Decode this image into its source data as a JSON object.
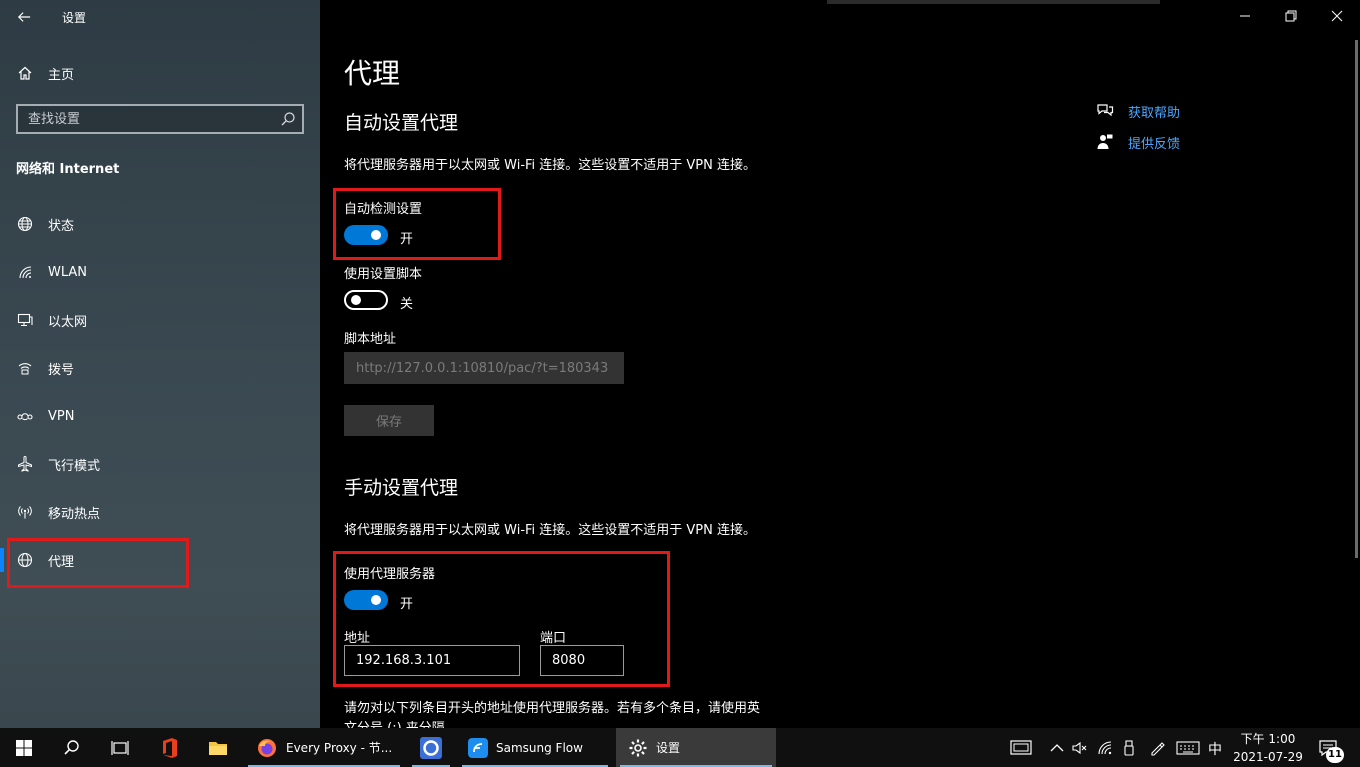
{
  "window": {
    "app_title": "设置",
    "back_icon": "back-arrow-icon",
    "minimize_icon": "minimize-icon",
    "restore_icon": "restore-icon",
    "close_icon": "close-icon"
  },
  "sidebar": {
    "home_label": "主页",
    "search_placeholder": "查找设置",
    "section_title": "网络和 Internet",
    "items": [
      {
        "label": "状态",
        "icon": "globe-status-icon"
      },
      {
        "label": "WLAN",
        "icon": "wifi-icon"
      },
      {
        "label": "以太网",
        "icon": "ethernet-icon"
      },
      {
        "label": "拨号",
        "icon": "dialup-icon"
      },
      {
        "label": "VPN",
        "icon": "vpn-icon"
      },
      {
        "label": "飞行模式",
        "icon": "airplane-icon"
      },
      {
        "label": "移动热点",
        "icon": "hotspot-icon"
      },
      {
        "label": "代理",
        "icon": "globe-icon",
        "selected": true
      }
    ]
  },
  "main": {
    "page_title": "代理",
    "auto": {
      "heading": "自动设置代理",
      "description": "将代理服务器用于以太网或 Wi-Fi 连接。这些设置不适用于 VPN 连接。",
      "detect_label": "自动检测设置",
      "detect_state": "开",
      "detect_on": true,
      "script_label": "使用设置脚本",
      "script_state": "关",
      "script_on": false,
      "address_label": "脚本地址",
      "address_value": "http://127.0.0.1:10810/pac/?t=180343",
      "save_label": "保存"
    },
    "manual": {
      "heading": "手动设置代理",
      "description": "将代理服务器用于以太网或 Wi-Fi 连接。这些设置不适用于 VPN 连接。",
      "use_proxy_label": "使用代理服务器",
      "use_proxy_state": "开",
      "use_proxy_on": true,
      "address_label": "地址",
      "address_value": "192.168.3.101",
      "port_label": "端口",
      "port_value": "8080",
      "exceptions_text_line1": "请勿对以下列条目开头的地址使用代理服务器。若有多个条目，请使用英",
      "exceptions_text_line2": "文分号 (;) 来分隔。"
    },
    "help": {
      "get_help": "获取帮助",
      "feedback": "提供反馈"
    }
  },
  "taskbar": {
    "apps": [
      {
        "label": "Every Proxy - 节..."
      },
      {
        "label": "Samsung Flow"
      },
      {
        "label": "设置"
      }
    ],
    "ime": "中",
    "time": "下午 1:00",
    "date": "2021-07-29",
    "notification_count": "11"
  },
  "colors": {
    "accent": "#0078d7",
    "highlight_box": "#e0191b",
    "link": "#4ca6ff"
  }
}
